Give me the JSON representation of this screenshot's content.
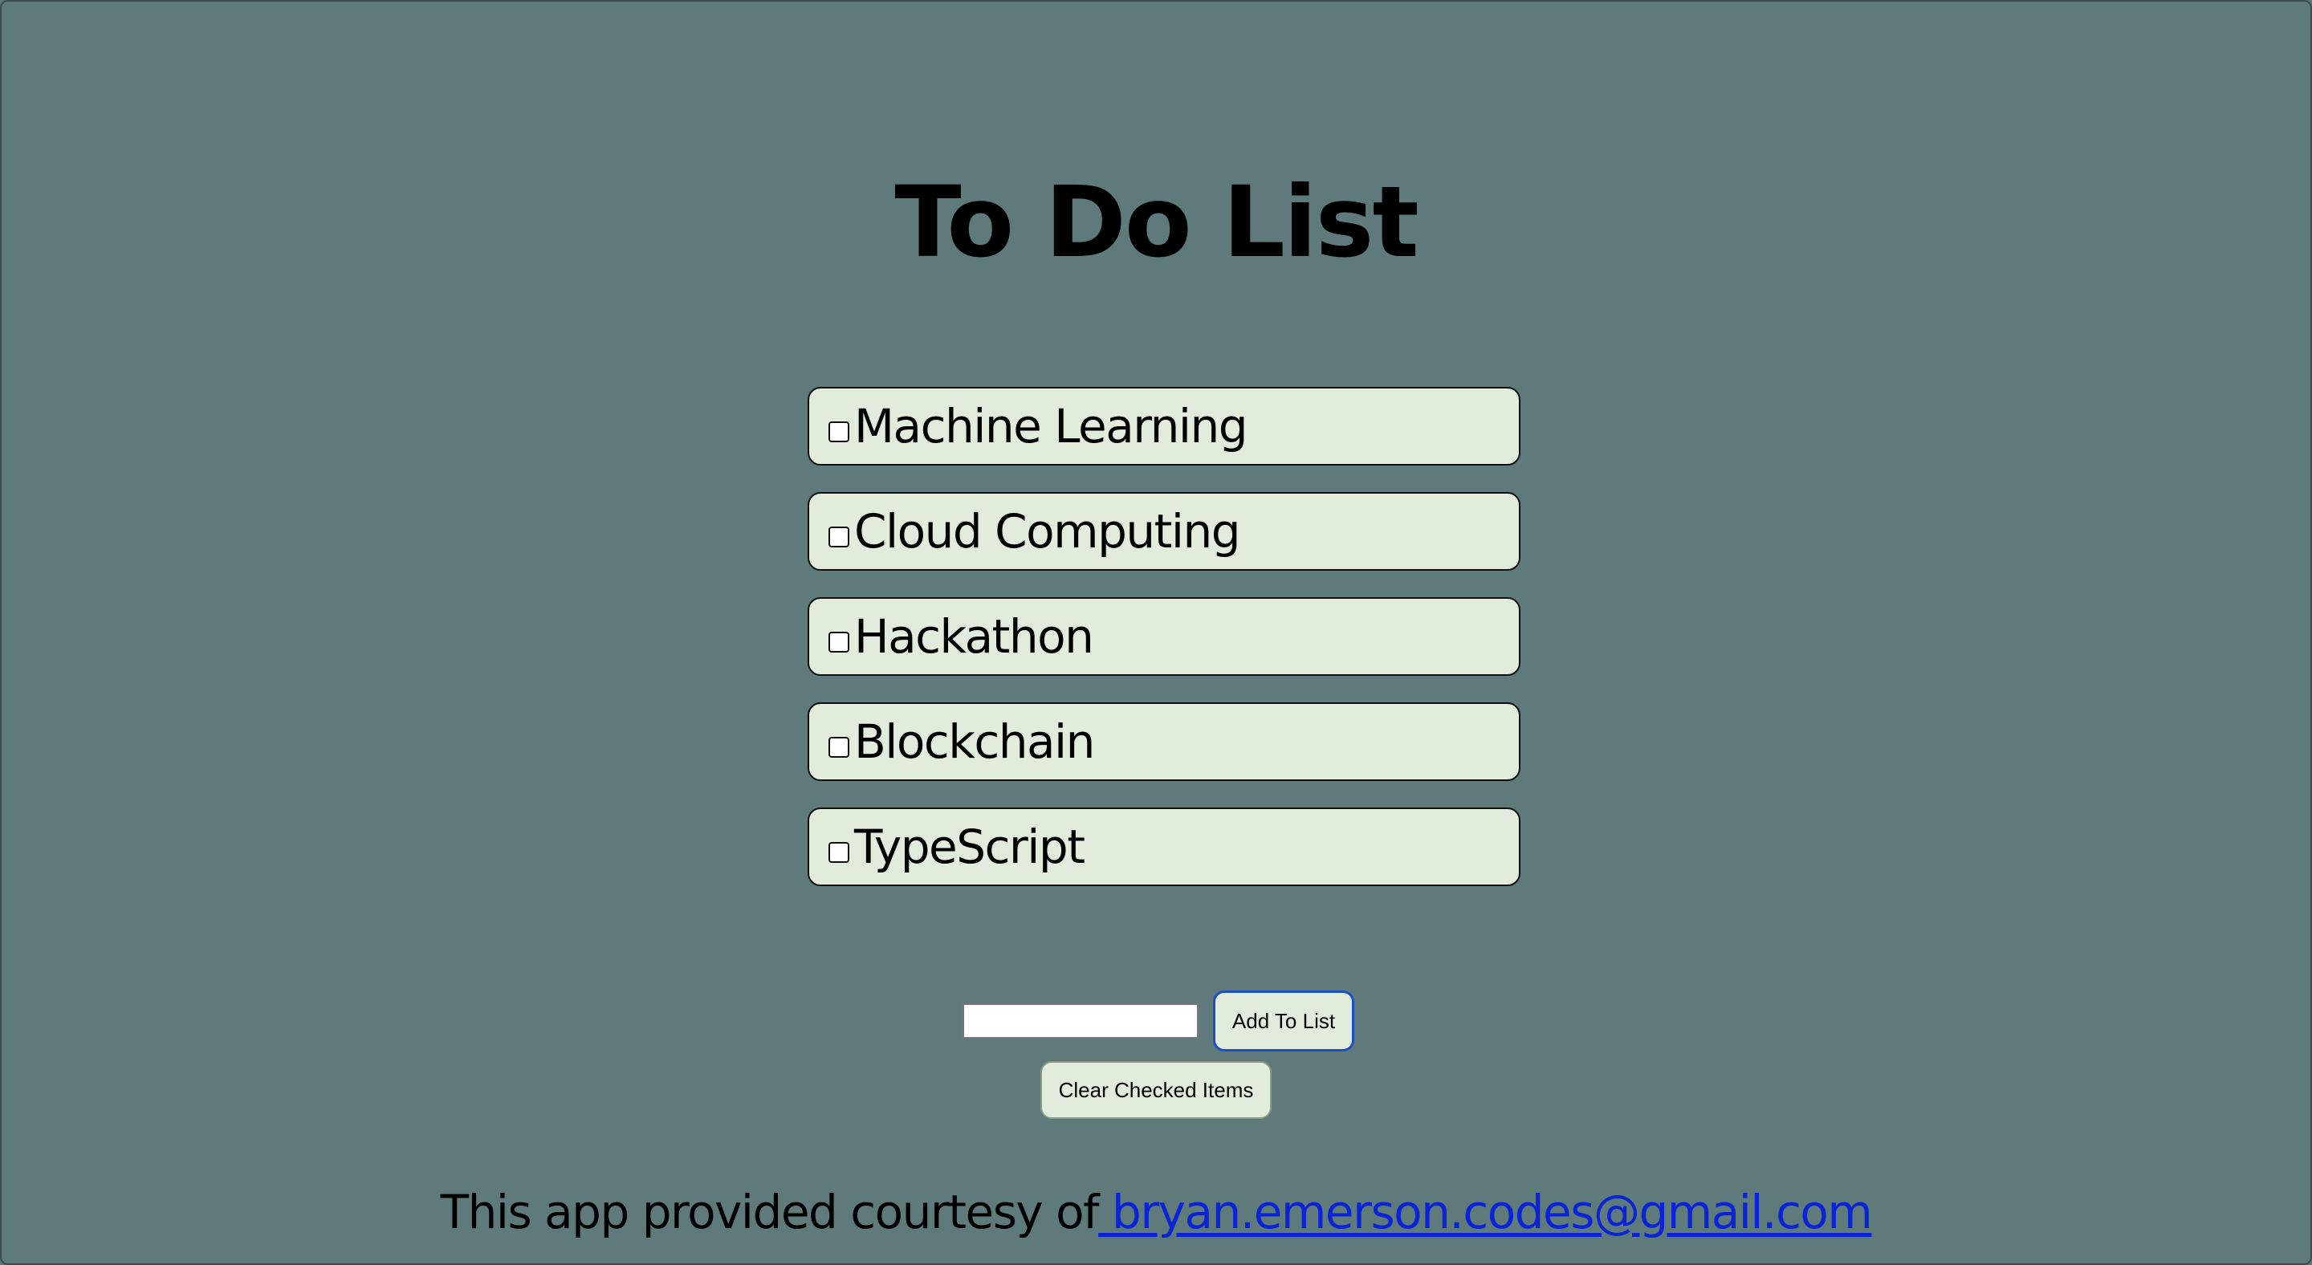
{
  "header": {
    "title": "To Do List"
  },
  "todo": {
    "items": [
      {
        "label": "Machine Learning",
        "checked": false
      },
      {
        "label": "Cloud Computing",
        "checked": false
      },
      {
        "label": "Hackathon",
        "checked": false
      },
      {
        "label": "Blockchain",
        "checked": false
      },
      {
        "label": "TypeScript",
        "checked": false
      }
    ]
  },
  "add_form": {
    "input_value": "",
    "input_placeholder": "",
    "add_button_label": "Add To List"
  },
  "actions": {
    "clear_button_label": "Clear Checked Items"
  },
  "footer": {
    "text": "This app provided courtesy of",
    "link_text": " bryan.emerson.codes@gmail.com"
  },
  "colors": {
    "background": "#5f7a7a",
    "item_background": "#e2ecdc",
    "link": "#0b23d6",
    "focus_ring": "#1d4fc2"
  }
}
